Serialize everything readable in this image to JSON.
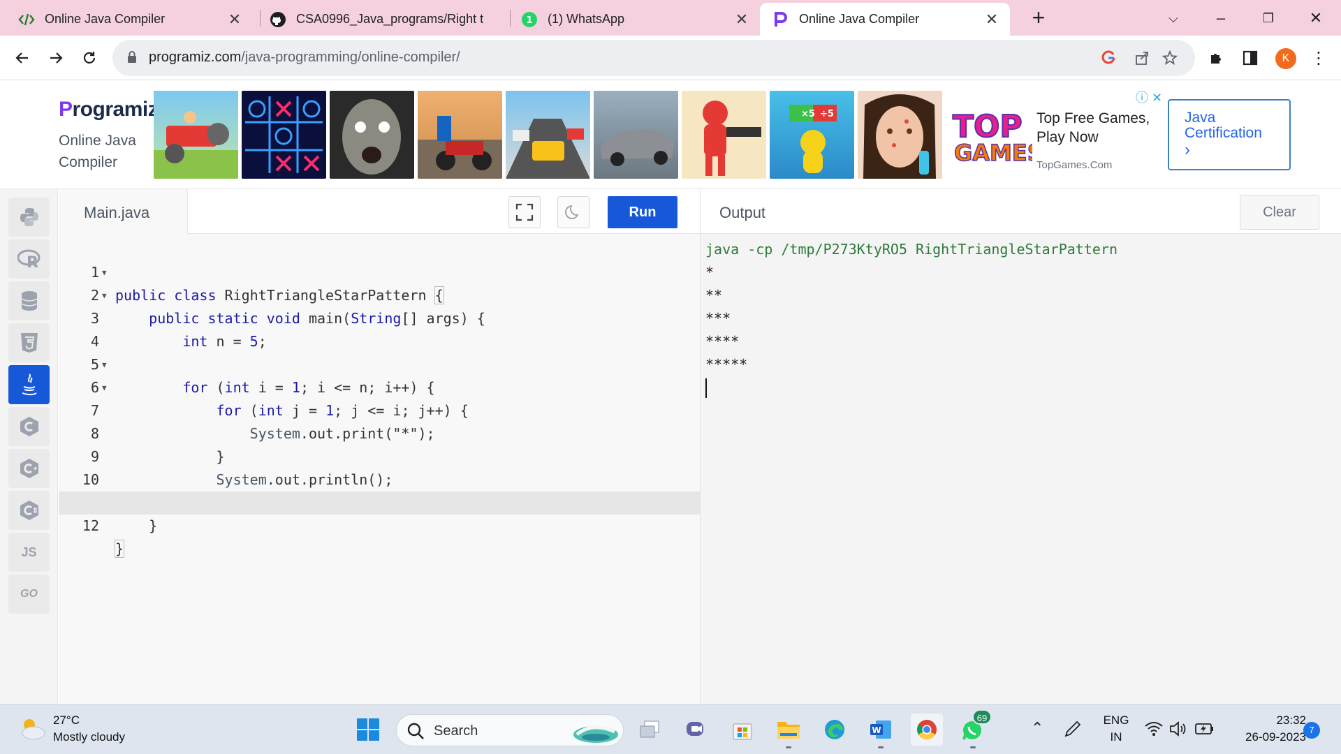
{
  "browser": {
    "tabs": [
      {
        "title": "Online Java Compiler",
        "icon": "code-icon",
        "active": false
      },
      {
        "title": "CSA0996_Java_programs/Right t",
        "icon": "github-icon",
        "active": false
      },
      {
        "title": "(1) WhatsApp",
        "icon": "whatsapp-icon",
        "active": false
      },
      {
        "title": "Online Java Compiler",
        "icon": "programiz-icon",
        "active": true
      }
    ],
    "url_host": "programiz.com",
    "url_path": "/java-programming/online-compiler/",
    "profile_initial": "K"
  },
  "header": {
    "logo": "rogramiz",
    "logo_letter": "P",
    "subtitle": "Online Java Compiler",
    "ad": {
      "brand_line1": "TOP",
      "brand_line2": "GAMES",
      "text_line1": "Top Free Games,",
      "text_line2": "Play Now",
      "site": "TopGames.Com"
    },
    "cert_button": "Java Certification",
    "cert_chevron": "›"
  },
  "sidebar": {
    "languages": [
      {
        "name": "Python",
        "icon": "python-icon",
        "active": false
      },
      {
        "name": "R",
        "icon": "r-icon",
        "active": false
      },
      {
        "name": "SQL",
        "icon": "database-icon",
        "active": false
      },
      {
        "name": "HTML",
        "icon": "html5-icon",
        "active": false
      },
      {
        "name": "Java",
        "icon": "java-icon",
        "active": true
      },
      {
        "name": "C",
        "icon": "c-icon",
        "active": false
      },
      {
        "name": "C++",
        "icon": "cpp-icon",
        "active": false
      },
      {
        "name": "C#",
        "icon": "csharp-icon",
        "active": false
      },
      {
        "name": "JS",
        "label": "JS",
        "active": false
      },
      {
        "name": "Go",
        "label": "GO",
        "active": false
      }
    ]
  },
  "editor": {
    "filename": "Main.java",
    "run_label": "Run",
    "lines": [
      "public class RightTriangleStarPattern {",
      "    public static void main(String[] args) {",
      "        int n = 5;",
      "",
      "        for (int i = 1; i <= n; i++) {",
      "            for (int j = 1; j <= i; j++) {",
      "                System.out.print(\"*\");",
      "            }",
      "            System.out.println();",
      "        }",
      "    }",
      "}"
    ]
  },
  "output": {
    "label": "Output",
    "clear_label": "Clear",
    "lines": [
      "java -cp /tmp/P273KtyRO5 RightTriangleStarPattern",
      "*",
      "**",
      "***",
      "****",
      "*****"
    ]
  },
  "taskbar": {
    "weather_temp": "27°C",
    "weather_desc": "Mostly cloudy",
    "search_placeholder": "Search",
    "whatsapp_badge": "69",
    "lang_line1": "ENG",
    "lang_line2": "IN",
    "time": "23:32",
    "date": "26-09-2023",
    "notification_count": "7"
  }
}
